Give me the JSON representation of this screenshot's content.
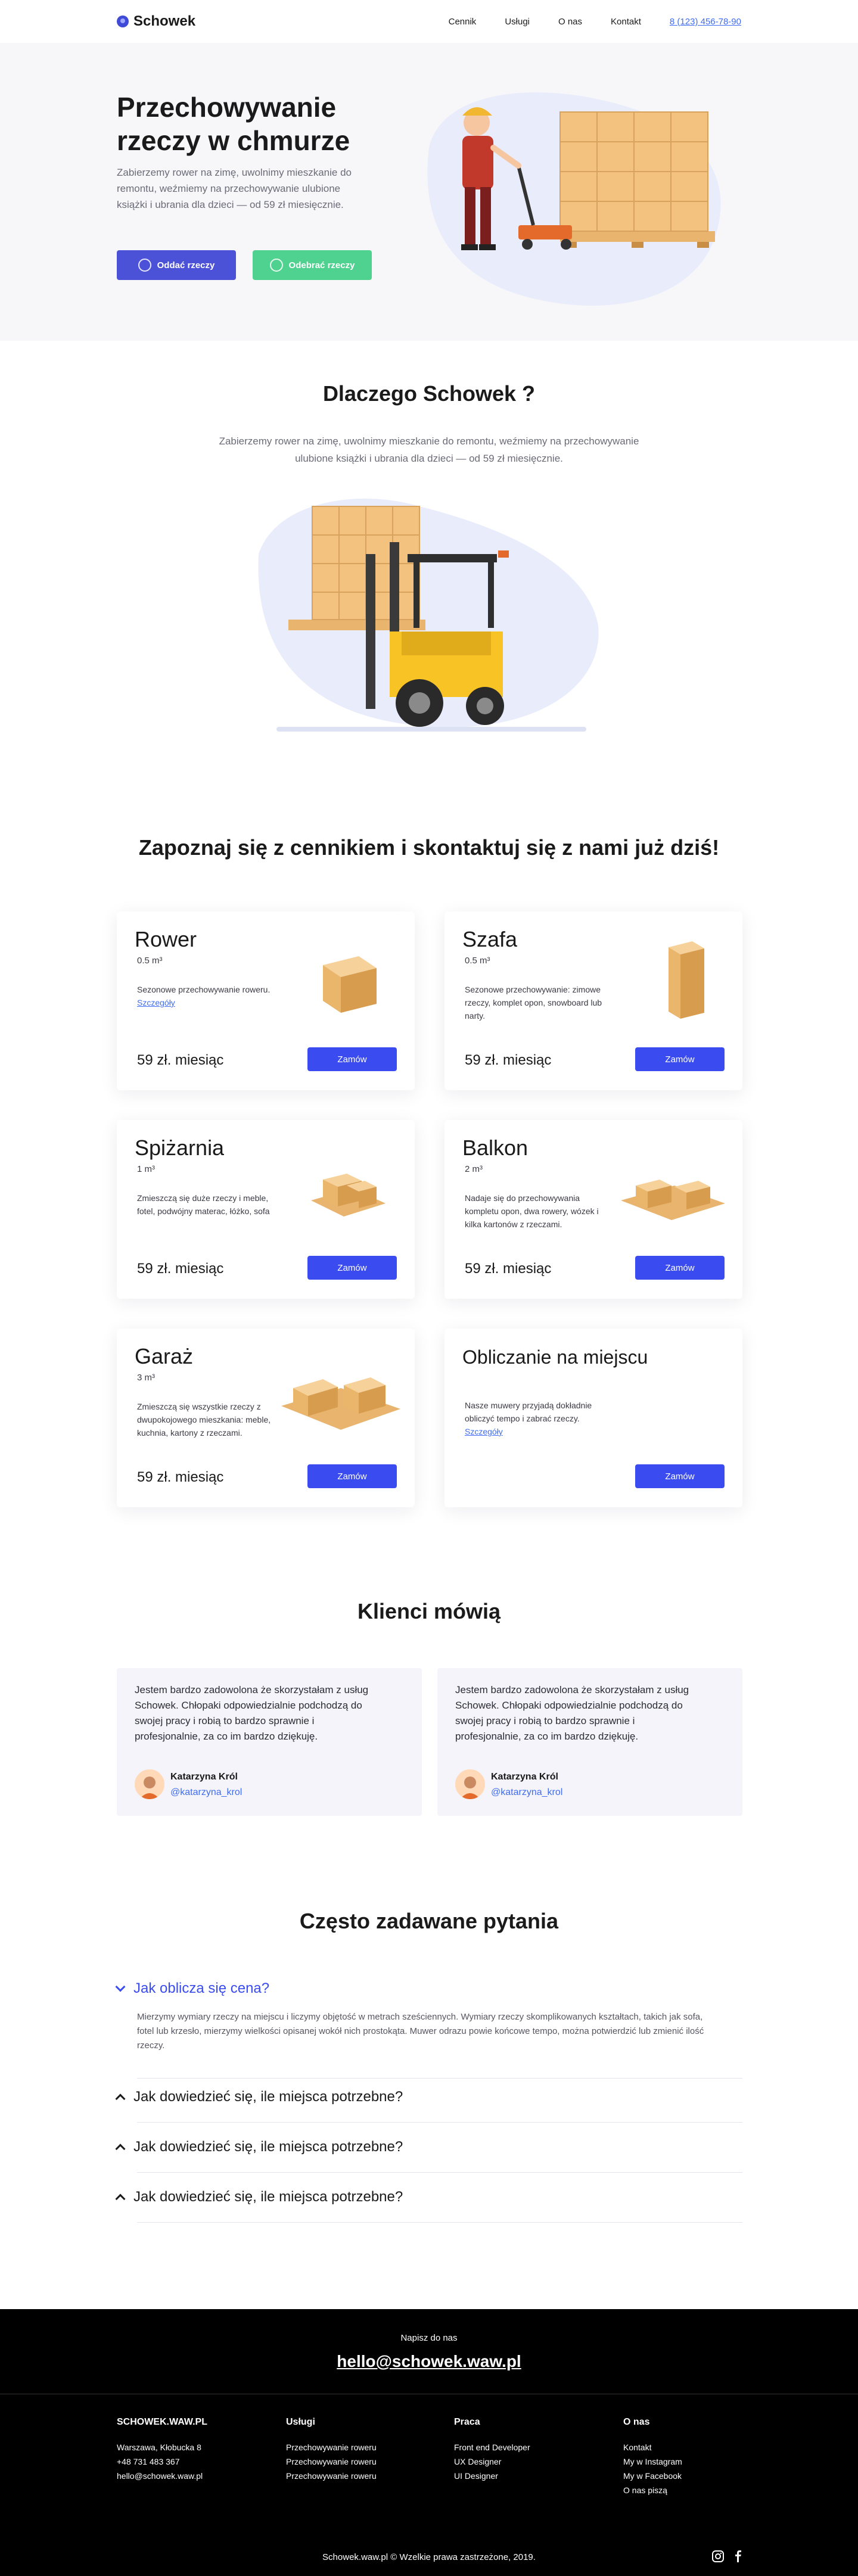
{
  "header": {
    "logo": "Schowek",
    "nav": [
      "Cennik",
      "Usługi",
      "O nas",
      "Kontakt"
    ],
    "phone": "8 (123) 456-78-90"
  },
  "hero": {
    "title": "Przechowywanie rzeczy w chmurze",
    "lead": "Zabierzemy rower na zimę, uwolnimy mieszkanie do remontu, weźmiemy na przechowywanie ulubione książki i ubrania dla dzieci — od 59 zł miesięcznie.",
    "btn_give": "Oddać rzeczy",
    "btn_take": "Odebrać rzeczy"
  },
  "why": {
    "title": "Dlaczego Schowek ?",
    "text": "Zabierzemy rower na zimę, uwolnimy mieszkanie do remontu, weźmiemy na przechowywanie ulubione książki i ubrania dla dzieci — od 59 zł miesięcznie."
  },
  "pricing": {
    "title": "Zapoznaj się z cennikiem i skontaktuj się z nami już dziś!",
    "order_label": "Zamów",
    "cards": [
      {
        "name": "Rower",
        "size": "0.5 m³",
        "desc": "Sezonowe przechowywanie roweru.",
        "link": "Szczegóły",
        "price": "59 zł. miesiąc"
      },
      {
        "name": "Szafa",
        "size": "0.5 m³",
        "desc": "Sezonowe przechowywanie: zimowe rzeczy, komplet opon, snowboard lub narty.",
        "price": "59 zł. miesiąc"
      },
      {
        "name": "Spiżarnia",
        "size": "1 m³",
        "desc": "Zmieszczą się duże rzeczy i meble, fotel, podwójny materac, łóżko, sofa",
        "price": "59 zł. miesiąc"
      },
      {
        "name": "Balkon",
        "size": "2 m³",
        "desc": "Nadaje się do przechowywania kompletu opon, dwa rowery, wózek i kilka kartonów z rzeczami.",
        "price": "59 zł. miesiąc"
      },
      {
        "name": "Garaż",
        "size": "3 m³",
        "desc": "Zmieszczą się wszystkie rzeczy z dwupokojowego mieszkania: meble, kuchnia, kartony z rzeczami.",
        "price": "59 zł. miesiąc"
      },
      {
        "name": "Obliczanie na miejscu",
        "desc": "Nasze muwery przyjadą dokładnie obliczyć tempo i zabrać rzeczy.",
        "link": "Szczegóły"
      }
    ]
  },
  "reviews": {
    "title": "Klienci mówią",
    "items": [
      {
        "text": "Jestem bardzo zadowolona że skorzystałam z usług Schowek. Chłopaki odpowiedzialnie podchodzą do swojej pracy i robią to bardzo sprawnie i profesjonalnie, za co im bardzo dziękuję.",
        "author": "Katarzyna Król",
        "handle": "@katarzyna_krol"
      },
      {
        "text": "Jestem bardzo zadowolona że skorzystałam z usług Schowek. Chłopaki odpowiedzialnie podchodzą do swojej pracy i robią to bardzo sprawnie i profesjonalnie, za co im bardzo dziękuję.",
        "author": "Katarzyna Król",
        "handle": "@katarzyna_krol"
      }
    ]
  },
  "faq": {
    "title": "Często zadawane pytania",
    "items": [
      {
        "q": "Jak oblicza się cena?",
        "a": "Mierzymy wymiary rzeczy na miejscu i liczymy objętość w metrach sześciennych. Wymiary rzeczy skomplikowanych kształtach, takich jak sofa, fotel lub krzesło, mierzymy wielkości opisanej wokół nich prostokąta. Muwer odrazu powie końcowe tempo, można potwierdzić lub zmienić ilość rzeczy."
      },
      {
        "q": "Jak dowiedzieć się, ile miejsca potrzebne?"
      },
      {
        "q": "Jak dowiedzieć się, ile miejsca potrzebne?"
      },
      {
        "q": "Jak dowiedzieć się, ile miejsca potrzebne?"
      }
    ]
  },
  "footer": {
    "write_label": "Napisz do nas",
    "email": "hello@schowek.waw.pl",
    "col1": {
      "title": "SCHOWEK.WAW.PL",
      "items": [
        "Warszawa, Kłobucka 8",
        "+48 731 483 367",
        "hello@schowek.waw.pl"
      ]
    },
    "col2": {
      "title": "Usługi",
      "items": [
        "Przechowywanie roweru",
        "Przechowywanie roweru",
        "Przechowywanie roweru"
      ]
    },
    "col3": {
      "title": "Praca",
      "items": [
        "Front end Developer",
        "UX Designer",
        "UI Designer"
      ]
    },
    "col4": {
      "title": "O nas",
      "items": [
        "Kontakt",
        "My w Instagram",
        "My w Facebook",
        "O nas piszą"
      ]
    },
    "copyright": "Schowek.waw.pl © Wzelkie prawa zastrzeżone, 2019."
  }
}
